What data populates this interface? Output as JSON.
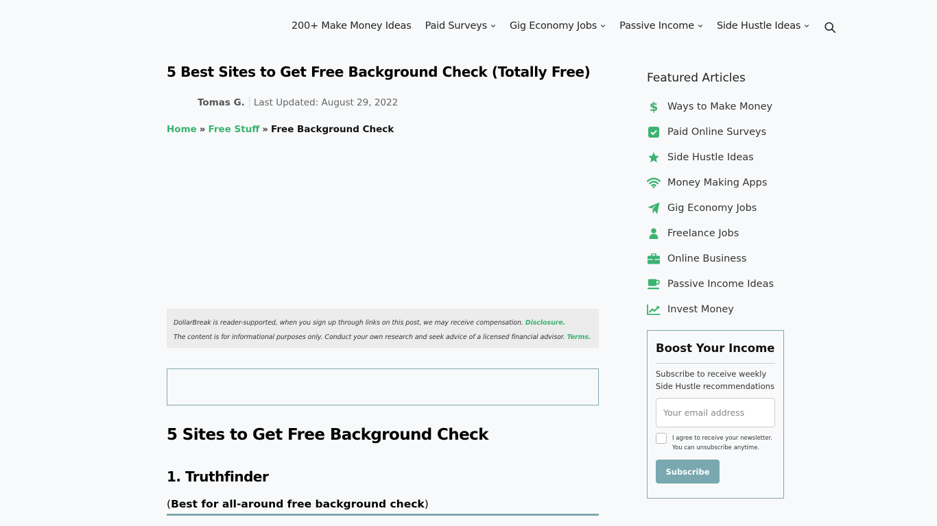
{
  "nav": {
    "items": [
      {
        "label": "200+ Make Money Ideas",
        "has_dropdown": false
      },
      {
        "label": "Paid Surveys",
        "has_dropdown": true
      },
      {
        "label": "Gig Economy Jobs",
        "has_dropdown": true
      },
      {
        "label": "Passive Income",
        "has_dropdown": true
      },
      {
        "label": "Side Hustle Ideas",
        "has_dropdown": true
      }
    ],
    "search_icon": "search-icon"
  },
  "article": {
    "title": "5 Best Sites to Get Free Background Check (Totally Free)",
    "author": "Tomas G.",
    "updated": "Last Updated: August 29, 2022",
    "breadcrumb": {
      "home": "Home",
      "sep": "»",
      "category": "Free Stuff",
      "current": "Free Background Check"
    },
    "disclosure": {
      "line1": "DollarBreak is reader-supported, when you sign up through links on this post, we may receive compensation.",
      "line1_link": "Disclosure.",
      "line2": "The content is for informational purposes only. Conduct your own research and seek advice of a licensed financial advisor.",
      "line2_link": "Terms."
    },
    "h2": "5 Sites to Get Free Background Check",
    "h3": "1. Truthfinder",
    "subtitle_open": "(",
    "subtitle_bold": "Best for all-around free background check",
    "subtitle_close": ")"
  },
  "sidebar": {
    "featured_title": "Featured Articles",
    "featured": [
      {
        "label": "Ways to Make Money",
        "icon": "dollar-icon"
      },
      {
        "label": "Paid Online Surveys",
        "icon": "checkbox-icon"
      },
      {
        "label": "Side Hustle Ideas",
        "icon": "star-icon"
      },
      {
        "label": "Money Making Apps",
        "icon": "wifi-icon"
      },
      {
        "label": "Gig Economy Jobs",
        "icon": "paper-plane-icon"
      },
      {
        "label": "Freelance Jobs",
        "icon": "user-icon"
      },
      {
        "label": "Online Business",
        "icon": "briefcase-icon"
      },
      {
        "label": "Passive Income Ideas",
        "icon": "coffee-cup-icon"
      },
      {
        "label": "Invest Money",
        "icon": "chart-line-icon"
      }
    ],
    "newsletter": {
      "title": "Boost Your Income",
      "description": "Subscribe to receive weekly Side Hustle recommendations",
      "email_placeholder": "Your email address",
      "email_value": "",
      "agree_text": "I agree to receive your newsletter. You can unsubscribe anytime.",
      "button": "Subscribe"
    }
  },
  "colors": {
    "accent_green": "#3cb371",
    "accent_teal": "#7aa8b0",
    "background": "#f8f9fa"
  }
}
